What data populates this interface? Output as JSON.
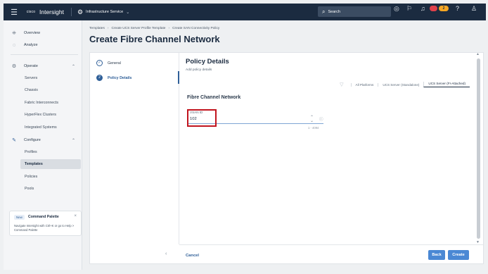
{
  "topbar": {
    "cisco_logo": "cisco",
    "app_name": "Intersight",
    "service": "Infrastructure Service",
    "search_placeholder": "Search",
    "alert_orange_count": "2"
  },
  "sidebar": {
    "overview": "Overview",
    "analyze": "Analyze",
    "operate": "Operate",
    "operate_items": [
      "Servers",
      "Chassis",
      "Fabric Interconnects",
      "HyperFlex Clusters",
      "Integrated Systems"
    ],
    "configure": "Configure",
    "configure_items": [
      "Profiles",
      "Templates",
      "Policies",
      "Pools"
    ],
    "active_item": "Templates",
    "palette": {
      "badge": "New",
      "title": "Command Palette",
      "text": "Navigate Intersight with Ctrl+K or go to Help > Command Palette"
    }
  },
  "breadcrumb": [
    "Templates",
    "Create UCS Server Profile Template",
    "Create SAN Connectivity Policy"
  ],
  "page_title": "Create Fibre Channel Network",
  "wizard": {
    "steps": [
      {
        "label": "General",
        "marker": "✓"
      },
      {
        "label": "Policy Details",
        "marker": "2"
      }
    ],
    "current_step": 2
  },
  "panel": {
    "title": "Policy Details",
    "subtitle": "Add policy details",
    "filters": [
      "All Platforms",
      "UCS Server (Standalone)",
      "UCS Server (FI-Attached)"
    ],
    "selected_filter": "UCS Server (FI-Attached)",
    "section": "Fibre Channel Network",
    "vsan_label": "VSAN ID",
    "vsan_value": "102",
    "vsan_range": "1 - 4094"
  },
  "footer": {
    "cancel": "Cancel",
    "back": "Back",
    "create": "Create"
  },
  "colors": {
    "topbar": "#1b2b40",
    "accent": "#2f5f98",
    "button": "#4a88d4",
    "highlight": "#c1141e"
  }
}
